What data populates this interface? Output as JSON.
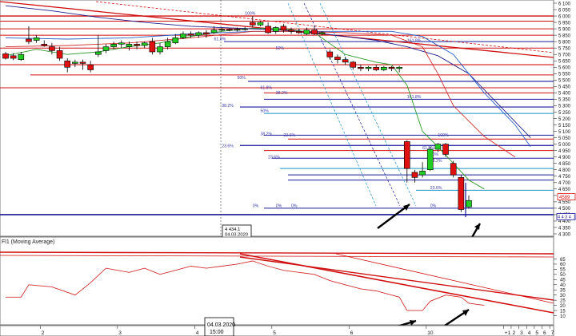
{
  "chart_data": [
    {
      "type": "candlestick",
      "ylim": [
        4300,
        6100
      ],
      "y_ticks": [
        6100,
        6050,
        6000,
        5950,
        5900,
        5850,
        5800,
        5750,
        5700,
        5650,
        5600,
        5550,
        5500,
        5450,
        5400,
        5350,
        5300,
        5250,
        5200,
        5150,
        5100,
        5050,
        5000,
        4950,
        4900,
        4850,
        4800,
        4750,
        4700,
        4650,
        4600,
        4550,
        4500,
        4450,
        4400,
        4350,
        4300
      ],
      "y_tick_labels": [
        "6 100",
        "6 050",
        "6 000",
        "5 950",
        "5 900",
        "5 850",
        "5 800",
        "5 750",
        "5 700",
        "5 650",
        "5 600",
        "5 550",
        "5 500",
        "5 450",
        "5 400",
        "5 350",
        "5 300",
        "5 250",
        "5 200",
        "5 150",
        "5 100",
        "5 050",
        "5 000",
        "4 950",
        "4 900",
        "4 850",
        "4 800",
        "4 750",
        "4 700",
        "4 650",
        "4 600",
        "4 550",
        "4 500",
        "4 450",
        "4 400",
        "4 350",
        "4 300"
      ],
      "x_ticks": [
        {
          "label": "2",
          "slot": 2
        },
        {
          "label": "3",
          "slot": 12
        },
        {
          "label": "4",
          "slot": 22
        },
        {
          "label": "5",
          "slot": 32
        },
        {
          "label": "6",
          "slot": 42
        },
        {
          "label": "10",
          "slot": 52
        },
        {
          "label": "+1",
          "slot": 62
        },
        {
          "label": "2",
          "slot": 63
        },
        {
          "label": "3",
          "slot": 64
        },
        {
          "label": "4",
          "slot": 65
        },
        {
          "label": "5",
          "slot": 66
        },
        {
          "label": "6",
          "slot": 67
        },
        {
          "label": "7",
          "slot": 68
        }
      ],
      "candles": [
        {
          "slot": 0,
          "o": 5705,
          "h": 5720,
          "c": 5670,
          "l": 5660
        },
        {
          "slot": 1,
          "o": 5690,
          "h": 5710,
          "c": 5670,
          "l": 5655
        },
        {
          "slot": 2,
          "o": 5660,
          "h": 5720,
          "c": 5700,
          "l": 5650
        },
        {
          "slot": 3,
          "o": 5820,
          "h": 5920,
          "c": 5800,
          "l": 5780
        },
        {
          "slot": 4,
          "o": 5810,
          "h": 5850,
          "c": 5830,
          "l": 5790
        },
        {
          "slot": 5,
          "o": 5780,
          "h": 5810,
          "c": 5770,
          "l": 5760
        },
        {
          "slot": 6,
          "o": 5760,
          "h": 5790,
          "c": 5730,
          "l": 5700
        },
        {
          "slot": 7,
          "o": 5730,
          "h": 5760,
          "c": 5670,
          "l": 5650
        },
        {
          "slot": 8,
          "o": 5650,
          "h": 5670,
          "c": 5600,
          "l": 5560
        },
        {
          "slot": 9,
          "o": 5630,
          "h": 5660,
          "c": 5640,
          "l": 5600
        },
        {
          "slot": 10,
          "o": 5640,
          "h": 5660,
          "c": 5630,
          "l": 5580
        },
        {
          "slot": 11,
          "o": 5620,
          "h": 5650,
          "c": 5580,
          "l": 5560
        },
        {
          "slot": 12,
          "o": 5700,
          "h": 5850,
          "c": 5720,
          "l": 5680
        },
        {
          "slot": 13,
          "o": 5730,
          "h": 5780,
          "c": 5760,
          "l": 5710
        },
        {
          "slot": 14,
          "o": 5760,
          "h": 5800,
          "c": 5780,
          "l": 5740
        },
        {
          "slot": 15,
          "o": 5780,
          "h": 5810,
          "c": 5790,
          "l": 5750
        },
        {
          "slot": 16,
          "o": 5760,
          "h": 5800,
          "c": 5780,
          "l": 5730
        },
        {
          "slot": 17,
          "o": 5780,
          "h": 5800,
          "c": 5770,
          "l": 5740
        },
        {
          "slot": 18,
          "o": 5770,
          "h": 5800,
          "c": 5790,
          "l": 5750
        },
        {
          "slot": 19,
          "o": 5800,
          "h": 5830,
          "c": 5720,
          "l": 5700
        },
        {
          "slot": 20,
          "o": 5720,
          "h": 5790,
          "c": 5760,
          "l": 5700
        },
        {
          "slot": 21,
          "o": 5760,
          "h": 5830,
          "c": 5800,
          "l": 5740
        },
        {
          "slot": 22,
          "o": 5790,
          "h": 5860,
          "c": 5830,
          "l": 5780
        },
        {
          "slot": 23,
          "o": 5830,
          "h": 5880,
          "c": 5860,
          "l": 5820
        },
        {
          "slot": 24,
          "o": 5860,
          "h": 5880,
          "c": 5850,
          "l": 5830
        },
        {
          "slot": 25,
          "o": 5850,
          "h": 5880,
          "c": 5870,
          "l": 5830
        },
        {
          "slot": 26,
          "o": 5870,
          "h": 5890,
          "c": 5860,
          "l": 5830
        },
        {
          "slot": 27,
          "o": 5870,
          "h": 5920,
          "c": 5890,
          "l": 5860
        },
        {
          "slot": 28,
          "o": 5890,
          "h": 5910,
          "c": 5895,
          "l": 5880
        },
        {
          "slot": 29,
          "o": 5895,
          "h": 5905,
          "c": 5890,
          "l": 5880
        },
        {
          "slot": 30,
          "o": 5890,
          "h": 5910,
          "c": 5895,
          "l": 5880
        },
        {
          "slot": 31,
          "o": 5895,
          "h": 5915,
          "c": 5900,
          "l": 5885
        },
        {
          "slot": 32,
          "o": 5950,
          "h": 6000,
          "c": 5930,
          "l": 5910
        },
        {
          "slot": 33,
          "o": 5930,
          "h": 5960,
          "c": 5950,
          "l": 5920
        },
        {
          "slot": 34,
          "o": 5920,
          "h": 5950,
          "c": 5870,
          "l": 5860
        },
        {
          "slot": 35,
          "o": 5880,
          "h": 5920,
          "c": 5910,
          "l": 5860
        },
        {
          "slot": 36,
          "o": 5920,
          "h": 5940,
          "c": 5890,
          "l": 5870
        },
        {
          "slot": 37,
          "o": 5890,
          "h": 5910,
          "c": 5880,
          "l": 5860
        },
        {
          "slot": 38,
          "o": 5880,
          "h": 5900,
          "c": 5870,
          "l": 5860
        },
        {
          "slot": 39,
          "o": 5860,
          "h": 5910,
          "c": 5890,
          "l": 5850
        },
        {
          "slot": 40,
          "o": 5890,
          "h": 5920,
          "c": 5860,
          "l": 5850
        },
        {
          "slot": 41,
          "o": 5860,
          "h": 5880,
          "c": 5870,
          "l": 5850
        },
        {
          "slot": 42,
          "o": 5720,
          "h": 5740,
          "c": 5680,
          "l": 5660
        },
        {
          "slot": 43,
          "o": 5680,
          "h": 5700,
          "c": 5660,
          "l": 5630
        },
        {
          "slot": 44,
          "o": 5660,
          "h": 5680,
          "c": 5640,
          "l": 5620
        },
        {
          "slot": 45,
          "o": 5640,
          "h": 5650,
          "c": 5600,
          "l": 5580
        },
        {
          "slot": 46,
          "o": 5600,
          "h": 5620,
          "c": 5590,
          "l": 5570
        },
        {
          "slot": 47,
          "o": 5590,
          "h": 5610,
          "c": 5600,
          "l": 5570
        },
        {
          "slot": 48,
          "o": 5600,
          "h": 5620,
          "c": 5580,
          "l": 5570
        },
        {
          "slot": 49,
          "o": 5580,
          "h": 5610,
          "c": 5600,
          "l": 5570
        },
        {
          "slot": 50,
          "o": 5600,
          "h": 5610,
          "c": 5590,
          "l": 5570
        },
        {
          "slot": 51,
          "o": 5590,
          "h": 5610,
          "c": 5600,
          "l": 5560
        },
        {
          "slot": 52,
          "o": 5020,
          "h": 5030,
          "c": 4810,
          "l": 4700
        },
        {
          "slot": 53,
          "o": 4780,
          "h": 4800,
          "c": 4740,
          "l": 4700
        },
        {
          "slot": 54,
          "o": 4760,
          "h": 4860,
          "c": 4790,
          "l": 4740
        },
        {
          "slot": 55,
          "o": 4800,
          "h": 4980,
          "c": 4960,
          "l": 4790
        },
        {
          "slot": 56,
          "o": 4960,
          "h": 5010,
          "c": 5000,
          "l": 4940
        },
        {
          "slot": 57,
          "o": 5000,
          "h": 5010,
          "c": 4920,
          "l": 4900
        },
        {
          "slot": 58,
          "o": 4850,
          "h": 4870,
          "c": 4760,
          "l": 4740
        },
        {
          "slot": 59,
          "o": 4740,
          "h": 4760,
          "c": 4490,
          "l": 4470
        },
        {
          "slot": 60,
          "o": 4510,
          "h": 4600,
          "c": 4560,
          "l": 4500
        }
      ],
      "moving_averages": [
        {
          "color": "#2b9b2b",
          "points": [
            [
              0,
              5690
            ],
            [
              4,
              5740
            ],
            [
              8,
              5700
            ],
            [
              12,
              5720
            ],
            [
              16,
              5760
            ],
            [
              20,
              5790
            ],
            [
              24,
              5840
            ],
            [
              28,
              5880
            ],
            [
              32,
              5905
            ],
            [
              36,
              5900
            ],
            [
              40,
              5870
            ],
            [
              44,
              5700
            ],
            [
              48,
              5640
            ],
            [
              50,
              5620
            ],
            [
              52,
              5460
            ],
            [
              54,
              5100
            ],
            [
              56,
              4980
            ],
            [
              58,
              4850
            ],
            [
              60,
              4720
            ],
            [
              62,
              4650
            ]
          ]
        },
        {
          "color": "#1f1f8f",
          "points": [
            [
              0,
              6080
            ],
            [
              6,
              6040
            ],
            [
              12,
              5990
            ],
            [
              18,
              5950
            ],
            [
              24,
              5920
            ],
            [
              30,
              5905
            ],
            [
              36,
              5890
            ],
            [
              40,
              5870
            ],
            [
              44,
              5840
            ],
            [
              48,
              5810
            ],
            [
              52,
              5760
            ],
            [
              56,
              5690
            ],
            [
              60,
              5550
            ],
            [
              64,
              5300
            ],
            [
              68,
              5050
            ]
          ]
        },
        {
          "color": "#2a5ec8",
          "points": [
            [
              0,
              5830
            ],
            [
              8,
              5820
            ],
            [
              16,
              5830
            ],
            [
              24,
              5860
            ],
            [
              32,
              5880
            ],
            [
              38,
              5880
            ],
            [
              44,
              5880
            ],
            [
              50,
              5880
            ],
            [
              54,
              5840
            ],
            [
              58,
              5700
            ],
            [
              62,
              5400
            ],
            [
              66,
              5150
            ],
            [
              68,
              4980
            ]
          ]
        },
        {
          "color": "#d23030",
          "points": [
            [
              0,
              5760
            ],
            [
              8,
              5770
            ],
            [
              16,
              5790
            ],
            [
              24,
              5830
            ],
            [
              32,
              5880
            ],
            [
              38,
              5880
            ],
            [
              44,
              5870
            ],
            [
              50,
              5850
            ],
            [
              54,
              5760
            ],
            [
              56,
              5550
            ],
            [
              58,
              5300
            ],
            [
              62,
              5060
            ],
            [
              66,
              4900
            ]
          ]
        }
      ],
      "current_price": 4589,
      "current_price_label": "4589",
      "side_markers": [
        {
          "label": "4 4 3 4 .1",
          "value": 4434
        }
      ],
      "cursor_box": {
        "lines": [
          "4 434.1",
          "04.03.2020",
          "15:00"
        ]
      },
      "fib_labels": [
        {
          "text": "100%",
          "value": 6000,
          "slot": 31
        },
        {
          "text": "61.8%",
          "value": 5800,
          "slot": 27
        },
        {
          "text": "50%",
          "value": 5730,
          "slot": 35
        },
        {
          "text": "50%",
          "value": 5500,
          "slot": 30
        },
        {
          "text": "61.8%",
          "value": 5420,
          "slot": 33
        },
        {
          "text": "38.2%",
          "value": 5380,
          "slot": 35
        },
        {
          "text": "38.2%",
          "value": 5280,
          "slot": 28
        },
        {
          "text": "50%",
          "value": 5240,
          "slot": 33
        },
        {
          "text": "38.2%",
          "value": 5060,
          "slot": 33
        },
        {
          "text": "23.6%",
          "value": 5050,
          "slot": 36
        },
        {
          "text": "23.6%",
          "value": 4965,
          "slot": 28
        },
        {
          "text": "23.6%",
          "value": 4880,
          "slot": 34
        },
        {
          "text": "0%",
          "value": 4500,
          "slot": 32
        },
        {
          "text": "0%",
          "value": 4500,
          "slot": 35
        },
        {
          "text": "0%",
          "value": 4500,
          "slot": 37
        },
        {
          "text": "161.8%",
          "value": 5790,
          "slot": 52
        },
        {
          "text": "161.8%",
          "value": 5350,
          "slot": 52
        },
        {
          "text": "100%",
          "value": 5050,
          "slot": 56
        },
        {
          "text": "61.8%",
          "value": 4950,
          "slot": 54
        },
        {
          "text": "50%",
          "value": 4900,
          "slot": 55
        },
        {
          "text": "38.2%",
          "value": 4850,
          "slot": 55
        },
        {
          "text": "23.6%",
          "value": 4640,
          "slot": 55
        },
        {
          "text": "0%",
          "value": 4500,
          "slot": 55
        }
      ]
    },
    {
      "type": "line",
      "indicator_label": "Fl1 (Moving Average)",
      "ylim": [
        5,
        70
      ],
      "y_ticks": [
        65,
        60,
        55,
        50,
        45,
        40,
        35,
        30,
        25,
        20,
        15,
        10
      ],
      "series": [
        {
          "color": "#d23030",
          "values": [
            [
              0,
              28
            ],
            [
              2,
              28
            ],
            [
              3,
              40
            ],
            [
              6,
              38
            ],
            [
              9,
              30
            ],
            [
              11,
              42
            ],
            [
              13,
              56
            ],
            [
              16,
              52
            ],
            [
              18,
              56
            ],
            [
              20,
              50
            ],
            [
              22,
              54
            ],
            [
              24,
              58
            ],
            [
              26,
              56
            ],
            [
              28,
              58
            ],
            [
              30,
              60
            ],
            [
              32,
              63
            ],
            [
              34,
              58
            ],
            [
              36,
              54
            ],
            [
              38,
              52
            ],
            [
              40,
              50
            ],
            [
              42,
              44
            ],
            [
              44,
              40
            ],
            [
              46,
              36
            ],
            [
              48,
              34
            ],
            [
              50,
              30
            ],
            [
              51,
              28
            ],
            [
              52,
              15
            ],
            [
              54,
              15
            ],
            [
              55,
              24
            ],
            [
              57,
              30
            ],
            [
              59,
              28
            ],
            [
              60,
              22
            ],
            [
              62,
              20
            ]
          ]
        }
      ]
    }
  ],
  "cursor_time_label": [
    "04.03.2020",
    "15:00"
  ]
}
